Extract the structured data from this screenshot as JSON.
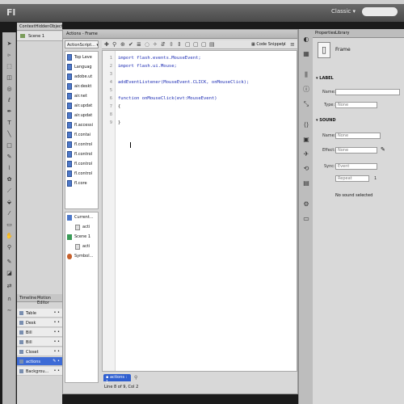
{
  "app": {
    "logo": "Fl",
    "workspace": "Classic"
  },
  "document": {
    "tab_title": "ContextHiddenObjectGame",
    "scene": "Scene 1"
  },
  "timeline": {
    "tabs": [
      "Timeline",
      "Motion Editor"
    ],
    "layers": [
      {
        "name": "Table",
        "selected": false
      },
      {
        "name": "Desk",
        "selected": false
      },
      {
        "name": "Bill",
        "selected": false
      },
      {
        "name": "Bill",
        "selected": false
      },
      {
        "name": "Closet",
        "selected": false
      },
      {
        "name": "actions",
        "selected": true
      },
      {
        "name": "Backgrou...",
        "selected": false
      }
    ]
  },
  "actions_panel": {
    "title": "Actions - Frame",
    "version_dropdown": "ActionScript...",
    "library": [
      "Top Leve",
      "Languag",
      "adobe.ut",
      "air.deskt",
      "air.net",
      "air.updat",
      "air.updat",
      "fl.accessi",
      "fl.contai",
      "fl.control",
      "fl.control",
      "fl.control",
      "fl.control",
      "fl.core"
    ],
    "tree": [
      {
        "label": "Current...",
        "icon": "folder"
      },
      {
        "label": "acti",
        "icon": "script"
      },
      {
        "label": "Scene 1",
        "icon": "scene"
      },
      {
        "label": "acti",
        "icon": "script"
      },
      {
        "label": "Symbol...",
        "icon": "movieclip"
      }
    ],
    "code_snippets": "Code Snippets",
    "lines": [
      {
        "num": "1",
        "text": "import flash.events.MouseEvent;"
      },
      {
        "num": "2",
        "text": "import flash.ui.Mouse;"
      },
      {
        "num": "3",
        "text": ""
      },
      {
        "num": "4",
        "text": "addEventListener(MouseEvent.CLICK, onMouseClick);"
      },
      {
        "num": "5",
        "text": ""
      },
      {
        "num": "6",
        "text": "function onMouseClick(evt:MouseEvent)"
      },
      {
        "num": "7",
        "text": "{"
      },
      {
        "num": "8",
        "text": ""
      },
      {
        "num": "9",
        "text": "}"
      }
    ],
    "script_tab": "actions : 1",
    "status": "Line 8 of 9, Col 2"
  },
  "properties": {
    "tabs": [
      "Properties",
      "Library"
    ],
    "frame_label": "Frame",
    "label_section": "LABEL",
    "name_label": "Name:",
    "type_label": "Type:",
    "type_value": "None",
    "sound_section": "SOUND",
    "sound_name_label": "Name:",
    "sound_name_value": "None",
    "effect_label": "Effect:",
    "effect_value": "None",
    "sync_label": "Sync:",
    "sync_value": "Event",
    "repeat_value": "Repeat",
    "repeat_count": "1",
    "no_sound": "No sound selected"
  },
  "colors": {
    "selection": "#3d6bd6",
    "keyword": "#1c2cb4"
  }
}
